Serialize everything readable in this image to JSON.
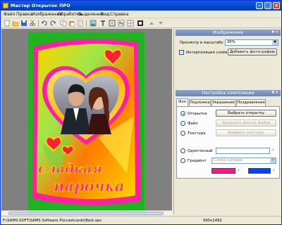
{
  "window": {
    "title": "Мастер Открыток ПРО"
  },
  "menu": [
    "Файл",
    "Правка",
    "Изображение",
    "Обработка",
    "Выделение",
    "Вид",
    "Справка"
  ],
  "toolbar": {
    "icons": [
      "new-icon",
      "open-icon",
      "save-icon",
      "cut-icon",
      "undo-icon",
      "redo-icon",
      "copy-icon",
      "paste-icon",
      "delete-icon",
      "image-icon",
      "text-icon",
      "frame-icon",
      "layers-icon",
      "grid-icon",
      "effects-icon",
      "up-icon",
      "down-icon"
    ]
  },
  "card": {
    "text_line1": "сладкая",
    "text_line2": "парочка",
    "colors": {
      "border": "#2bbd2b",
      "frame": "#ff2aa8",
      "heart": "#ff2a4a"
    }
  },
  "panel_image": {
    "header": "Изображение",
    "zoom_label": "Просмотр в масштабе",
    "zoom_value": "36%",
    "interpolation_label": "Интерполяция слоёв",
    "interpolation_checked": true,
    "add_photo_label": "Добавить фотографию"
  },
  "panel_composition": {
    "header": "Настройка композиции",
    "tabs": [
      "Фон",
      "Подложка",
      "Украшения",
      "Поздравления"
    ],
    "active_tab": "Фон",
    "options": [
      {
        "label": "Открытка",
        "button": "Выбрать открытку",
        "selected": true,
        "enabled": true
      },
      {
        "label": "Файл",
        "button": "Загрузить фон из файла",
        "selected": false,
        "enabled": false
      },
      {
        "label": "Текстура",
        "button": "Выбрать текстуру",
        "selected": false,
        "enabled": false
      }
    ],
    "solid_label": "Однотонный",
    "gradient_label": "Градиент",
    "gradient_value": "Слева направо",
    "gradient_colors": [
      "#ff1493",
      "#0044ff"
    ]
  },
  "status": {
    "path": "F:\\SAMS-SOFT\\SAMS Software Россия\\cards\\Best.aps",
    "size": "995x1492"
  }
}
